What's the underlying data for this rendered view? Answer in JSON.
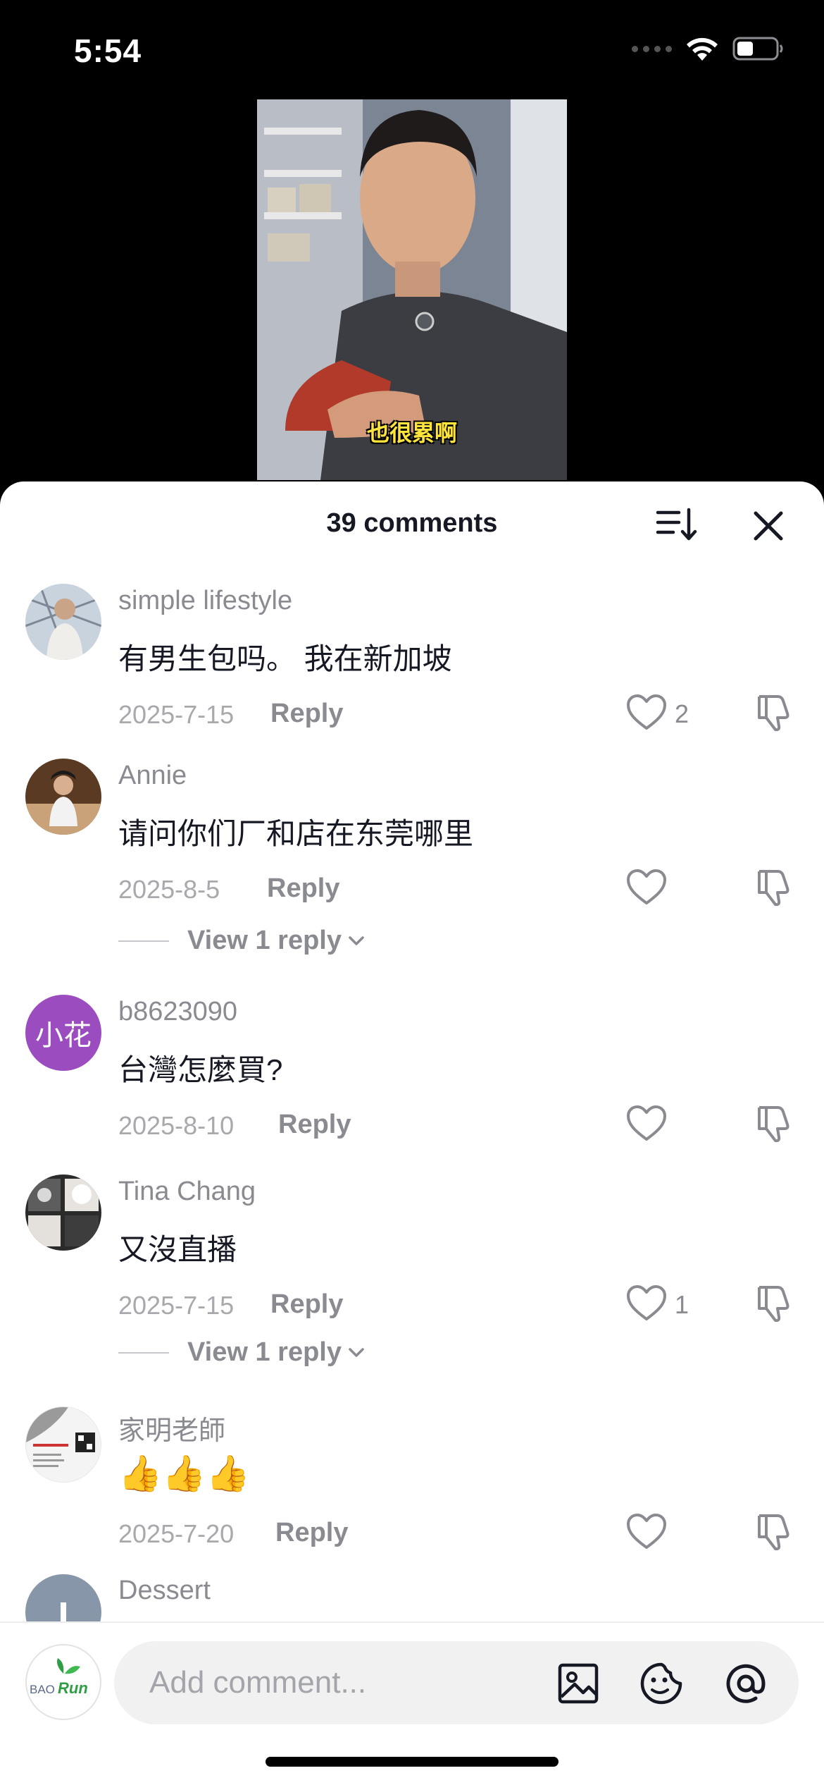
{
  "status_bar": {
    "time": "5:54"
  },
  "video": {
    "caption": "也很累啊"
  },
  "header": {
    "comments_count": "39 comments"
  },
  "comments": [
    {
      "username": "simple lifestyle",
      "text": "有男生包吗。 我在新加坡",
      "date": "2025-7-15",
      "reply_label": "Reply",
      "likes": "2"
    },
    {
      "username": "Annie",
      "text": "请问你们厂和店在东莞哪里",
      "date": "2025-8-5",
      "reply_label": "Reply",
      "likes": "",
      "view_replies": "View 1 reply"
    },
    {
      "username": "b8623090",
      "avatar_text": "小花",
      "text": "台灣怎麼買?",
      "date": "2025-8-10",
      "reply_label": "Reply",
      "likes": ""
    },
    {
      "username": "Tina Chang",
      "text": "又沒直播",
      "date": "2025-7-15",
      "reply_label": "Reply",
      "likes": "1",
      "view_replies": "View 1 reply"
    },
    {
      "username": "家明老師",
      "text": "👍👍👍",
      "date": "2025-7-20",
      "reply_label": "Reply",
      "likes": ""
    },
    {
      "username": "Dessert",
      "text": "",
      "date": "",
      "reply_label": "",
      "likes": ""
    }
  ],
  "composer": {
    "placeholder": "Add comment...",
    "avatar_logo": {
      "left": "BAO",
      "right": "Run"
    }
  },
  "icons": [
    "signal-icon",
    "wifi-icon",
    "battery-icon",
    "sort-icon",
    "close-icon",
    "heart-icon",
    "dislike-icon",
    "chevron-down-icon",
    "image-icon",
    "sticker-icon",
    "mention-icon"
  ],
  "colors": {
    "accent_purple": "#9b4dc0",
    "logo_green": "#2f9e44",
    "text_primary": "#161823",
    "text_secondary": "#8a8b91"
  }
}
